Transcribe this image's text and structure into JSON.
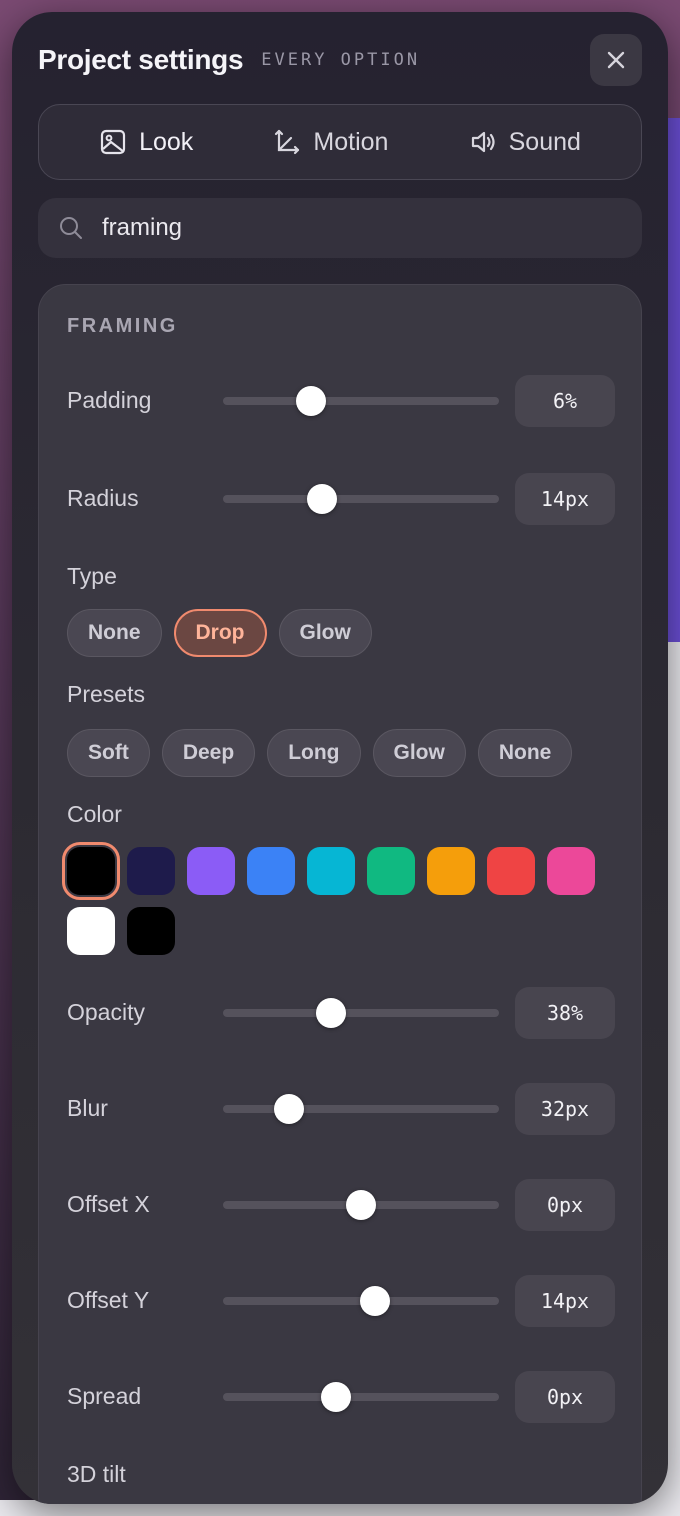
{
  "panel": {
    "title": "Project settings",
    "subtitle": "EVERY OPTION",
    "close_icon": "close-icon"
  },
  "tabs": [
    {
      "label": "Look",
      "icon": "image-icon"
    },
    {
      "label": "Motion",
      "icon": "motion-axes-icon"
    },
    {
      "label": "Sound",
      "icon": "speaker-icon"
    }
  ],
  "search": {
    "value": "framing",
    "icon": "search-icon"
  },
  "section": {
    "title": "FRAMING",
    "padding": {
      "label": "Padding",
      "value": "6%",
      "level": 0.32
    },
    "radius": {
      "label": "Radius",
      "value": "14px",
      "level": 0.36
    },
    "type": {
      "label": "Type",
      "options": [
        "None",
        "Drop",
        "Glow"
      ],
      "selected": "Drop"
    },
    "presets": {
      "label": "Presets",
      "options": [
        "Soft",
        "Deep",
        "Long",
        "Glow",
        "None"
      ]
    },
    "color": {
      "label": "Color",
      "swatches": [
        "#000000",
        "#1e1b4b",
        "#8b5cf6",
        "#3b82f6",
        "#06b6d4",
        "#10b981",
        "#f59e0b",
        "#ef4444",
        "#ec4899",
        "#ffffff",
        "#000000"
      ],
      "selected_index": 0
    },
    "opacity": {
      "label": "Opacity",
      "value": "38%",
      "level": 0.39
    },
    "blur": {
      "label": "Blur",
      "value": "32px",
      "level": 0.24
    },
    "offset_x": {
      "label": "Offset X",
      "value": "0px",
      "level": 0.5
    },
    "offset_y": {
      "label": "Offset Y",
      "value": "14px",
      "level": 0.55
    },
    "spread": {
      "label": "Spread",
      "value": "0px",
      "level": 0.41
    },
    "tilt": {
      "label": "3D tilt"
    }
  },
  "colors": {
    "accent": "#f08a6e",
    "panel_bg": "#2c2a32",
    "section_bg": "#3a3842"
  }
}
